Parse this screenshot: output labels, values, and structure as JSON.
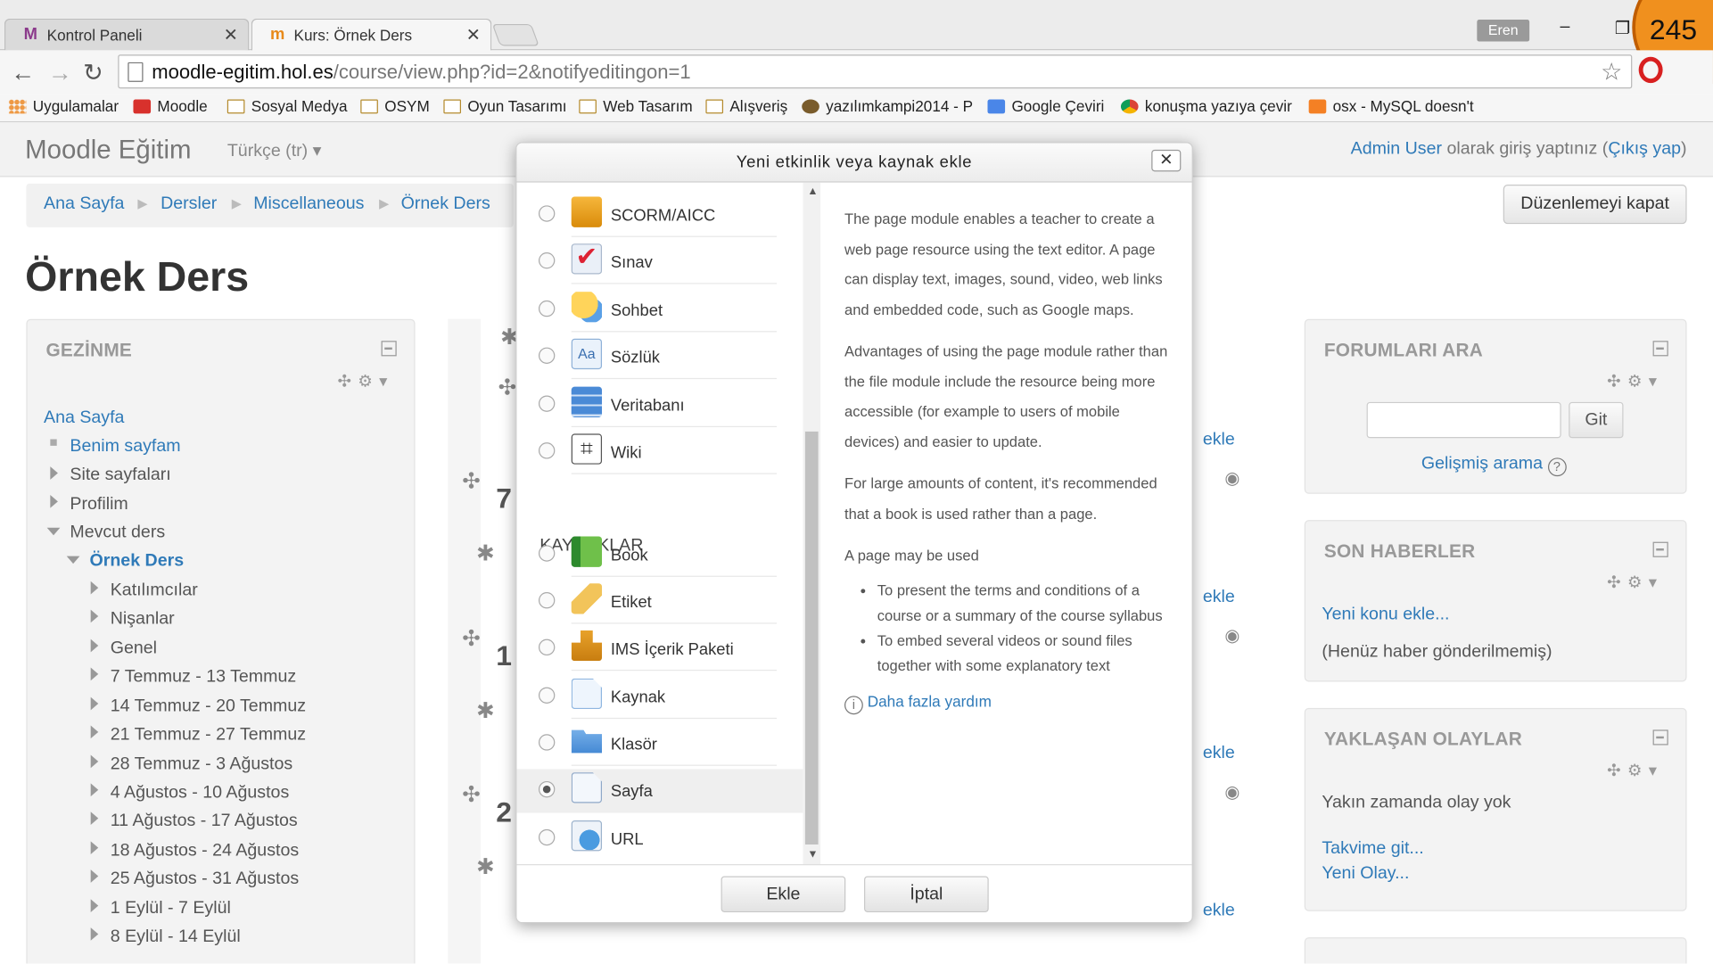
{
  "browser": {
    "tabs": [
      {
        "title": "Kontrol Paneli",
        "icon": "moodle-m-icon"
      },
      {
        "title": "Kurs: Örnek Ders",
        "icon": "moodle-hat-icon"
      }
    ],
    "user": "Eren",
    "badge": "245",
    "url_host": "moodle-egitim.hol.es",
    "url_path": "/course/view.php?id=2&notifyeditingon=1",
    "bookmarks": [
      "Uygulamalar",
      "Moodle",
      "Sosyal Medya",
      "OSYM",
      "Oyun Tasarımı",
      "Web Tasarım",
      "Alışveriş",
      "yazılımkampi2014 - P",
      "Google Çeviri",
      "konuşma yazıya çevir",
      "osx - MySQL doesn't"
    ]
  },
  "moodle": {
    "brand": "Moodle Eğitim",
    "language": "Türkçe (tr)",
    "login_user": "Admin User",
    "login_text": "olarak giriş yaptınız (",
    "logout": "Çıkış yap",
    "login_close": ")",
    "breadcrumbs": [
      "Ana Sayfa",
      "Dersler",
      "Miscellaneous",
      "Örnek Ders"
    ],
    "edit_button": "Düzenlemeyi kapat",
    "page_title": "Örnek Ders"
  },
  "nav_block": {
    "title": "GEZİNME",
    "home": "Ana Sayfa",
    "items": [
      "Benim sayfam",
      "Site sayfaları",
      "Profilim",
      "Mevcut ders",
      "Örnek Ders",
      "Katılımcılar",
      "Nişanlar",
      "Genel",
      "7 Temmuz - 13 Temmuz",
      "14 Temmuz - 20 Temmuz",
      "21 Temmuz - 27 Temmuz",
      "28 Temmuz - 3 Ağustos",
      "4 Ağustos - 10 Ağustos",
      "11 Ağustos - 17 Ağustos",
      "18 Ağustos - 24 Ağustos",
      "25 Ağustos - 31 Ağustos",
      "1 Eylül - 7 Eylül",
      "8 Eylül - 14 Eylül"
    ]
  },
  "middle": {
    "section_numbers": [
      "7",
      "1",
      "2"
    ],
    "ekle": "ekle"
  },
  "right_blocks": {
    "forum_title": "FORUMLARI ARA",
    "forum_go": "Git",
    "forum_advanced": "Gelişmiş arama",
    "news_title": "SON HABERLER",
    "news_add": "Yeni konu ekle...",
    "news_empty": "(Henüz haber gönderilmemiş)",
    "events_title": "YAKLAŞAN OLAYLAR",
    "events_empty": "Yakın zamanda olay yok",
    "events_calendar": "Takvime git...",
    "events_new": "Yeni Olay..."
  },
  "modal": {
    "title": "Yeni etkinlik veya kaynak ekle",
    "activities": [
      "SCORM/AICC",
      "Sınav",
      "Sohbet",
      "Sözlük",
      "Veritabanı",
      "Wiki"
    ],
    "resources_heading": "KAYNAKLAR",
    "resources": [
      "Book",
      "Etiket",
      "IMS İçerik Paketi",
      "Kaynak",
      "Klasör",
      "Sayfa",
      "URL"
    ],
    "selected": "Sayfa",
    "help_p1": "The page module enables a teacher to create a web page resource using the text editor. A page can display text, images, sound, video, web links and embedded code, such as Google maps.",
    "help_p2": "Advantages of using the page module rather than the file module include the resource being more accessible (for example to users of mobile devices) and easier to update.",
    "help_p3": "For large amounts of content, it's recommended that a book is used rather than a page.",
    "help_p4": "A page may be used",
    "help_list": [
      "To present the terms and conditions of a course or a summary of the course syllabus",
      "To embed several videos or sound files together with some explanatory text"
    ],
    "more_help": "Daha fazla yardım",
    "add_button": "Ekle",
    "cancel_button": "İptal"
  }
}
